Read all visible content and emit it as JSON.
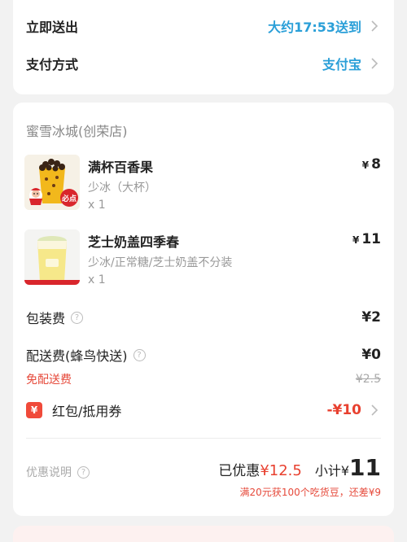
{
  "delivery": {
    "label": "立即送出",
    "value": "大约17:53送到"
  },
  "payment": {
    "label": "支付方式",
    "value": "支付宝"
  },
  "store": {
    "name": "蜜雪冰城(创荣店)"
  },
  "items": [
    {
      "name": "满杯百香果",
      "spec": "少冰（大杯）",
      "qty": "x 1",
      "currency": "¥",
      "price": "8",
      "badge": "必点"
    },
    {
      "name": "芝士奶盖四季春",
      "spec": "少冰/正常糖/芝士奶盖不分装",
      "qty": "x 1",
      "currency": "¥",
      "price": "11"
    }
  ],
  "fees": {
    "packaging_label": "包装费",
    "packaging_value": "¥2",
    "delivery_label": "配送费(蜂鸟快送)",
    "delivery_value": "¥0",
    "free_delivery_label": "免配送费",
    "original_delivery": "¥2.5",
    "coupon_label": "红包/抵用券",
    "coupon_value": "-¥10",
    "coupon_icon_text": "¥"
  },
  "summary": {
    "discount_note": "优惠说明",
    "saved_label": "已优惠",
    "saved_value": "¥12.5",
    "subtotal_label": "小计¥",
    "subtotal_value": "11",
    "promo": "满20元获100个吃货豆，还差¥9"
  },
  "colors": {
    "accent_blue": "#2a9fd8",
    "accent_red": "#e8402f",
    "background": "#f2f2f2"
  }
}
